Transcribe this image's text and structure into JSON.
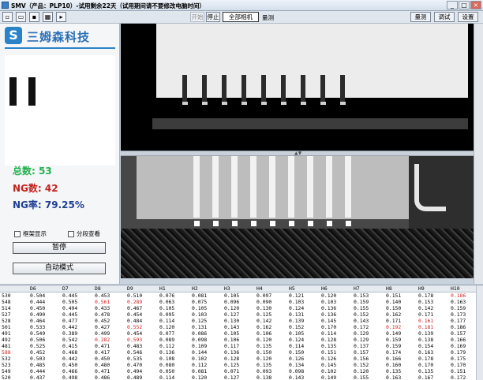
{
  "window": {
    "title": "SMV（产品：PLP10）-试用剩余22天（试用期间请不要修改电脑时间）",
    "controls": [
      "_",
      "□",
      "×"
    ]
  },
  "toolbar": {
    "start_label": "开始",
    "stop_label": "停止",
    "all_cameras_label": "全部相机",
    "measure_label": "量测",
    "right_buttons": [
      "量测",
      "调试",
      "设置"
    ]
  },
  "logo": {
    "mark": "S",
    "text": "三姆森科技"
  },
  "stats": {
    "total": "总数: 53",
    "ng": "NG数: 42",
    "ng_rate": "NG率: 79.25%"
  },
  "options": {
    "frame_display": "框架显示",
    "batch_view": "分段查看"
  },
  "buttons": {
    "pause": "暂停",
    "auto_mode": "自动模式"
  },
  "table": {
    "headers": [
      "",
      "D6",
      "D7",
      "D8",
      "D9",
      "H1",
      "H2",
      "H3",
      "H4",
      "H5",
      "H6",
      "H7",
      "H8",
      "H9",
      "H10"
    ],
    "rows": [
      {
        "cells": [
          "530",
          "0.504",
          "0.445",
          "0.453",
          "0.510",
          "0.076",
          "0.081",
          "0.105",
          "0.097",
          "0.121",
          "0.120",
          "0.153",
          "0.151",
          "0.178",
          "0.186"
        ],
        "red": [
          14
        ]
      },
      {
        "cells": [
          "548",
          "0.444",
          "0.505",
          "0.561",
          "0.289",
          "0.063",
          "0.075",
          "0.096",
          "0.090",
          "0.103",
          "0.103",
          "0.159",
          "0.140",
          "0.153",
          "0.163"
        ],
        "red": [
          3,
          4
        ]
      },
      {
        "cells": [
          "514",
          "0.450",
          "0.494",
          "0.433",
          "0.467",
          "0.105",
          "0.105",
          "0.120",
          "0.130",
          "0.124",
          "0.136",
          "0.155",
          "0.150",
          "0.142",
          "0.159"
        ],
        "red": []
      },
      {
        "cells": [
          "527",
          "0.490",
          "0.445",
          "0.478",
          "0.454",
          "0.095",
          "0.103",
          "0.127",
          "0.125",
          "0.131",
          "0.136",
          "0.152",
          "0.162",
          "0.171",
          "0.173"
        ],
        "red": []
      },
      {
        "cells": [
          "528",
          "0.464",
          "0.477",
          "0.452",
          "0.484",
          "0.114",
          "0.125",
          "0.130",
          "0.142",
          "0.139",
          "0.145",
          "0.143",
          "0.171",
          "0.161",
          "0.177"
        ],
        "red": [
          13
        ]
      },
      {
        "cells": [
          "501",
          "0.533",
          "0.442",
          "0.427",
          "0.552",
          "0.120",
          "0.131",
          "0.143",
          "0.162",
          "0.152",
          "0.170",
          "0.172",
          "0.192",
          "0.181",
          "0.186"
        ],
        "red": [
          4,
          12,
          13
        ]
      },
      {
        "cells": [
          "491",
          "0.549",
          "0.389",
          "0.499",
          "0.454",
          "0.077",
          "0.086",
          "0.105",
          "0.106",
          "0.105",
          "0.114",
          "0.129",
          "0.149",
          "0.139",
          "0.157"
        ],
        "red": []
      },
      {
        "cells": [
          "492",
          "0.506",
          "0.542",
          "0.282",
          "0.593",
          "0.089",
          "0.098",
          "0.106",
          "0.120",
          "0.124",
          "0.128",
          "0.129",
          "0.159",
          "0.138",
          "0.166"
        ],
        "red": [
          3,
          4
        ]
      },
      {
        "cells": [
          "481",
          "0.525",
          "0.415",
          "0.471",
          "0.483",
          "0.112",
          "0.109",
          "0.117",
          "0.135",
          "0.114",
          "0.135",
          "0.137",
          "0.159",
          "0.154",
          "0.169"
        ],
        "red": []
      },
      {
        "cells": [
          "588",
          "0.452",
          "0.468",
          "0.417",
          "0.546",
          "0.136",
          "0.144",
          "0.136",
          "0.150",
          "0.150",
          "0.151",
          "0.157",
          "0.174",
          "0.163",
          "0.179"
        ],
        "red": [
          0
        ]
      },
      {
        "cells": [
          "532",
          "0.503",
          "0.442",
          "0.450",
          "0.535",
          "0.108",
          "0.102",
          "0.128",
          "0.120",
          "0.126",
          "0.126",
          "0.156",
          "0.166",
          "0.178",
          "0.175"
        ],
        "red": []
      },
      {
        "cells": [
          "523",
          "0.485",
          "0.450",
          "0.480",
          "0.470",
          "0.080",
          "0.112",
          "0.125",
          "0.135",
          "0.134",
          "0.145",
          "0.152",
          "0.160",
          "0.170",
          "0.170"
        ],
        "red": []
      },
      {
        "cells": [
          "549",
          "0.444",
          "0.466",
          "0.471",
          "0.494",
          "0.050",
          "0.081",
          "0.071",
          "0.093",
          "0.098",
          "0.102",
          "0.120",
          "0.135",
          "0.135",
          "0.151"
        ],
        "red": []
      },
      {
        "cells": [
          "520",
          "0.437",
          "0.498",
          "0.486",
          "0.489",
          "0.114",
          "0.120",
          "0.127",
          "0.138",
          "0.143",
          "0.149",
          "0.155",
          "0.163",
          "0.167",
          "0.172"
        ],
        "red": []
      }
    ]
  }
}
